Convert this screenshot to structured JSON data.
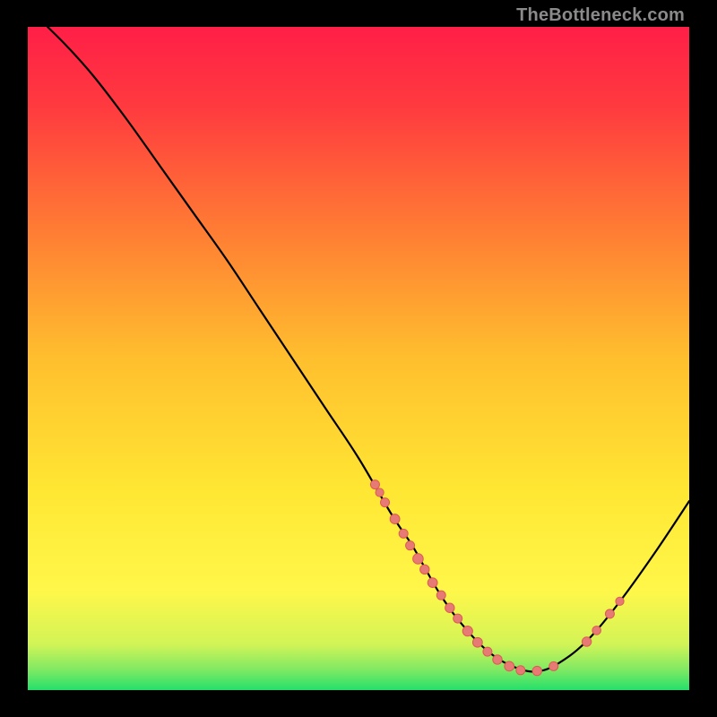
{
  "attribution": "TheBottleneck.com",
  "colors": {
    "gradient_top": "#ff1f47",
    "gradient_mid": "#ffe733",
    "gradient_bottom": "#23e06a",
    "curve": "#000000",
    "marker_fill": "#e77a74",
    "marker_stroke": "#dc5c53",
    "frame_bg": "#000000"
  },
  "chart_data": {
    "type": "line",
    "title": "",
    "xlabel": "",
    "ylabel": "",
    "xlim": [
      0,
      100
    ],
    "ylim": [
      0,
      100
    ],
    "grid": false,
    "series": [
      {
        "name": "curve",
        "x": [
          3,
          6,
          10,
          15,
          20,
          25,
          30,
          35,
          40,
          45,
          50,
          55,
          58,
          60,
          62,
          64,
          66,
          68,
          70,
          72,
          74,
          76,
          78,
          80,
          83,
          86,
          90,
          95,
          100
        ],
        "y": [
          100,
          97,
          92.5,
          86,
          79,
          72,
          65,
          57.5,
          50,
          42.5,
          35,
          26.5,
          22,
          18.5,
          15,
          12,
          9.5,
          7.3,
          5.5,
          4.2,
          3.3,
          2.8,
          3,
          3.9,
          6,
          9,
          14,
          21,
          28.5
        ]
      }
    ],
    "markers": [
      {
        "x": 52.5,
        "y": 31,
        "r": 5.0
      },
      {
        "x": 53.2,
        "y": 29.8,
        "r": 4.6
      },
      {
        "x": 54.0,
        "y": 28.3,
        "r": 5.0
      },
      {
        "x": 55.5,
        "y": 25.8,
        "r": 5.4
      },
      {
        "x": 56.8,
        "y": 23.6,
        "r": 5.0
      },
      {
        "x": 57.8,
        "y": 21.8,
        "r": 5.0
      },
      {
        "x": 59.0,
        "y": 19.8,
        "r": 5.8
      },
      {
        "x": 60.0,
        "y": 18.2,
        "r": 5.2
      },
      {
        "x": 61.2,
        "y": 16.2,
        "r": 5.4
      },
      {
        "x": 62.5,
        "y": 14.3,
        "r": 5.0
      },
      {
        "x": 63.8,
        "y": 12.4,
        "r": 5.2
      },
      {
        "x": 65.0,
        "y": 10.8,
        "r": 5.0
      },
      {
        "x": 66.5,
        "y": 8.9,
        "r": 5.6
      },
      {
        "x": 68.0,
        "y": 7.2,
        "r": 5.4
      },
      {
        "x": 69.5,
        "y": 5.8,
        "r": 5.0
      },
      {
        "x": 71.0,
        "y": 4.6,
        "r": 5.2
      },
      {
        "x": 72.8,
        "y": 3.6,
        "r": 5.4
      },
      {
        "x": 74.5,
        "y": 3.0,
        "r": 5.0
      },
      {
        "x": 77.0,
        "y": 2.9,
        "r": 5.2
      },
      {
        "x": 79.5,
        "y": 3.6,
        "r": 5.0
      },
      {
        "x": 84.5,
        "y": 7.3,
        "r": 5.2
      },
      {
        "x": 86.0,
        "y": 9.0,
        "r": 4.8
      },
      {
        "x": 88.0,
        "y": 11.5,
        "r": 5.0
      },
      {
        "x": 89.5,
        "y": 13.4,
        "r": 4.6
      }
    ]
  }
}
